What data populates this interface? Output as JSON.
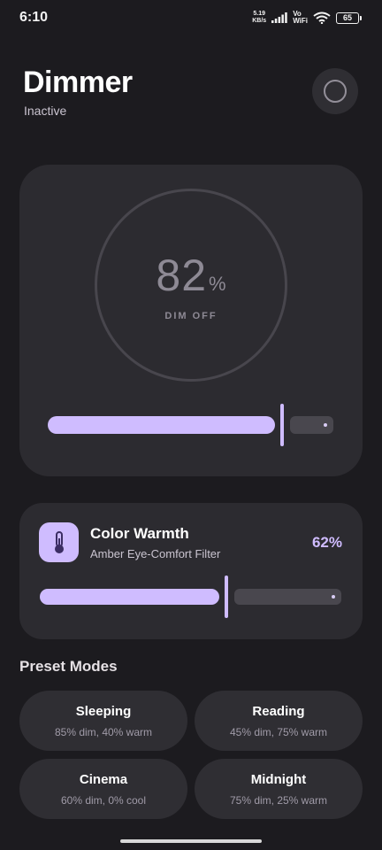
{
  "status_bar": {
    "time": "6:10",
    "speed_value": "5.19",
    "speed_unit": "KB/s",
    "network_label_top": "Vo",
    "network_label_bottom": "WiFi",
    "battery": "65"
  },
  "header": {
    "title": "Dimmer",
    "status": "Inactive"
  },
  "dim": {
    "value": "82",
    "unit": "%",
    "state_label": "DIM OFF",
    "slider_level": 0.82
  },
  "warmth": {
    "title": "Color Warmth",
    "subtitle": "Amber Eye-Comfort Filter",
    "value_label": "62%",
    "slider_level": 0.62,
    "icon": "thermometer-icon"
  },
  "presets": {
    "title": "Preset Modes",
    "items": [
      {
        "name": "Sleeping",
        "desc": "85% dim, 40% warm"
      },
      {
        "name": "Reading",
        "desc": "45% dim, 75% warm"
      },
      {
        "name": "Cinema",
        "desc": "60% dim, 0% cool"
      },
      {
        "name": "Midnight",
        "desc": "75% dim, 25% warm"
      }
    ]
  },
  "colors": {
    "background": "#1c1b1f",
    "card": "#2c2b30",
    "accent": "#cfbcff",
    "track": "#49474e"
  }
}
